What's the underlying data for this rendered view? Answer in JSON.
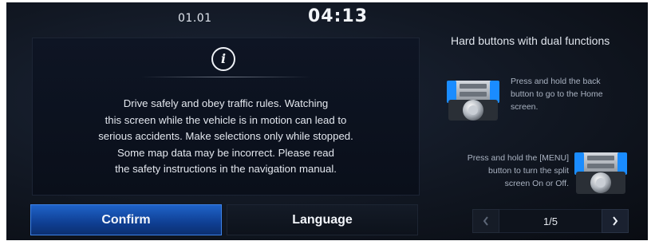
{
  "status_bar": {
    "date": "01.01",
    "time": "04:13"
  },
  "notice": {
    "lines": [
      "Drive safely and obey traffic rules. Watching",
      "this screen while the vehicle is in motion can lead to",
      "serious accidents. Make selections only while stopped.",
      "Some map data may be incorrect. Please read",
      "the safety instructions in the navigation manual."
    ],
    "icon": "info-icon"
  },
  "buttons": {
    "confirm": "Confirm",
    "language": "Language"
  },
  "hard_buttons": {
    "title": "Hard buttons with dual functions",
    "tip1": {
      "lines": [
        "Press and hold the back",
        "button to go to the Home",
        "screen."
      ],
      "icon": "head-unit-back-button-image"
    },
    "tip2": {
      "lines": [
        "Press and hold the [MENU]",
        "button to turn the split",
        "screen On or Off."
      ],
      "icon": "head-unit-menu-button-image"
    }
  },
  "pager": {
    "page": "1/5",
    "prev_icon": "chevron-left-icon",
    "next_icon": "chevron-right-icon"
  },
  "colors": {
    "accent": "#1f63c9",
    "background": "#111722"
  }
}
